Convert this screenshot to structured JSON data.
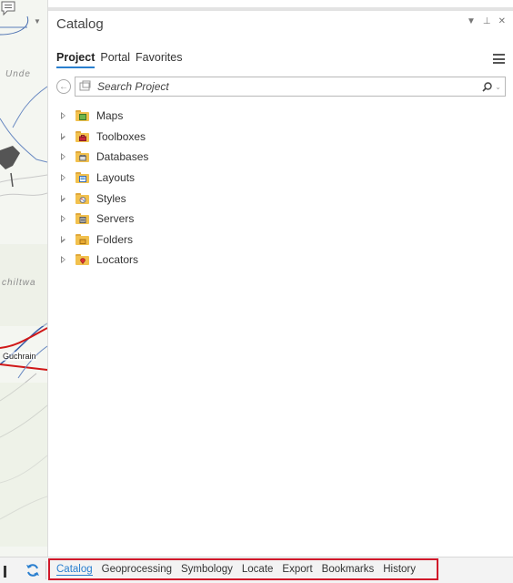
{
  "map": {
    "labels": [
      "Unde",
      "chiltwa"
    ],
    "place": "Guchrain"
  },
  "catalog": {
    "title": "Catalog",
    "tabs": [
      {
        "label": "Project",
        "active": true
      },
      {
        "label": "Portal",
        "active": false
      },
      {
        "label": "Favorites",
        "active": false
      }
    ],
    "search_placeholder": "Search Project",
    "items": [
      {
        "label": "Maps",
        "icon": "maps-folder-icon"
      },
      {
        "label": "Toolboxes",
        "icon": "toolboxes-folder-icon"
      },
      {
        "label": "Databases",
        "icon": "databases-folder-icon"
      },
      {
        "label": "Layouts",
        "icon": "layouts-folder-icon"
      },
      {
        "label": "Styles",
        "icon": "styles-folder-icon"
      },
      {
        "label": "Servers",
        "icon": "servers-folder-icon"
      },
      {
        "label": "Folders",
        "icon": "folders-folder-icon"
      },
      {
        "label": "Locators",
        "icon": "locators-folder-icon"
      }
    ]
  },
  "dock": {
    "tabs": [
      {
        "label": "Catalog",
        "active": true
      },
      {
        "label": "Geoprocessing",
        "active": false
      },
      {
        "label": "Symbology",
        "active": false
      },
      {
        "label": "Locate",
        "active": false
      },
      {
        "label": "Export",
        "active": false
      },
      {
        "label": "Bookmarks",
        "active": false
      },
      {
        "label": "History",
        "active": false
      }
    ]
  },
  "colors": {
    "accent": "#2a7fcf",
    "highlight_border": "#d0182a",
    "folder": "#f2c14e"
  }
}
